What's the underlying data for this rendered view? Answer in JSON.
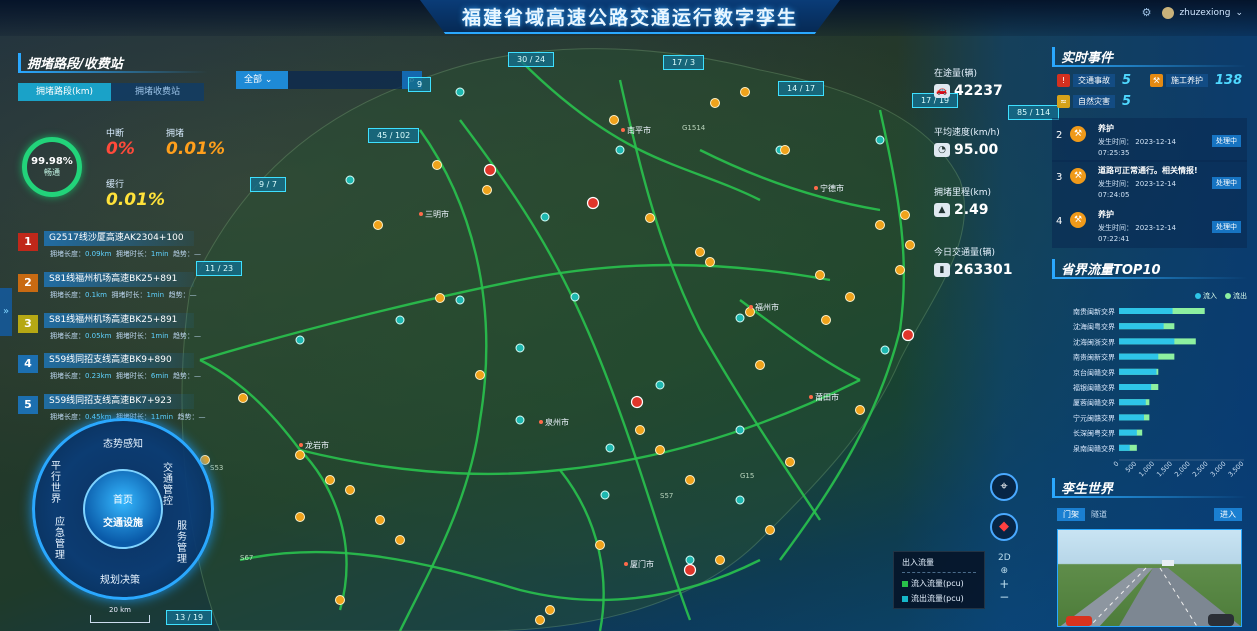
{
  "title": "福建省域高速公路交通运行数字孪生",
  "user": "zhuzexiong",
  "left": {
    "section_title": "拥堵路段/收费站",
    "tabs": [
      "拥堵路段(km)",
      "拥堵收费站"
    ],
    "ring_value": "99.98%",
    "ring_label": "畅通",
    "stats": [
      {
        "label": "中断",
        "value": "0%",
        "color": "#ff4a3a"
      },
      {
        "label": "拥堵",
        "value": "0.01%",
        "color": "#ff9f1c"
      },
      {
        "label": "缓行",
        "value": "0.01%",
        "color": "#ffe23a"
      }
    ],
    "jams": [
      {
        "rank": "1",
        "color": "#c0281a",
        "name": "G2517线沙厦高速AK2304+100",
        "len": "0.09km",
        "dur": "1min"
      },
      {
        "rank": "2",
        "color": "#c86a12",
        "name": "S81线福州机场高速BK25+891",
        "len": "0.1km",
        "dur": "1min"
      },
      {
        "rank": "3",
        "color": "#b6a814",
        "name": "S81线福州机场高速BK25+891",
        "len": "0.05km",
        "dur": "1min"
      },
      {
        "rank": "4",
        "color": "#1c6fb0",
        "name": "S59线同招支线高速BK9+890",
        "len": "0.23km",
        "dur": "6min"
      },
      {
        "rank": "5",
        "color": "#1c6fb0",
        "name": "S59线同招支线高速BK7+923",
        "len": "0.45km",
        "dur": "11min"
      }
    ],
    "jam_len_label": "拥堵长度：",
    "jam_dur_label": "拥堵时长：",
    "jam_trend_label": "趋势：",
    "jam_trend_value": "—"
  },
  "search": {
    "select": "全部"
  },
  "map": {
    "scale": "20 km",
    "seg_labels": [
      "30 / 24",
      "17 / 3",
      "14 / 17",
      "45 / 102",
      "9 / 7",
      "11 / 23",
      "85 / 114",
      "17 / 19",
      "13 / 19",
      "9"
    ],
    "cities": [
      "南平市",
      "宁德市",
      "福州市",
      "莆田市",
      "泉州市",
      "龙岩市",
      "厦门市",
      "三明市"
    ],
    "roads": [
      "G1514",
      "S57",
      "G15",
      "S67",
      "S53"
    ],
    "dial": {
      "segments": [
        "态势感知",
        "交通管控",
        "服务管理",
        "规划决策",
        "应急管理",
        "平行世界"
      ],
      "home": "首页",
      "current": "交通设施"
    },
    "controls": {
      "mode": "2D",
      "zoom_in": "+",
      "zoom_out": "−"
    }
  },
  "kpis": [
    {
      "label": "在途量(辆)",
      "value": "42237",
      "icon": "car-icon"
    },
    {
      "label": "平均速度(km/h)",
      "value": "95.00",
      "icon": "speedometer-icon"
    },
    {
      "label": "拥堵里程(km)",
      "value": "2.49",
      "icon": "road-icon"
    },
    {
      "label": "今日交通量(辆)",
      "value": "263301",
      "icon": "vehicle-icon"
    }
  ],
  "events": {
    "section_title": "实时事件",
    "chips": [
      {
        "label": "交通事故",
        "value": "5",
        "icon": "accident-icon"
      },
      {
        "label": "施工养护",
        "value": "138",
        "icon": "construction-icon"
      },
      {
        "label": "自然灾害",
        "value": "5",
        "icon": "disaster-icon"
      }
    ],
    "time_label": "发生时间：",
    "items": [
      {
        "idx": "2",
        "title": "养护",
        "date": "2023-12-14",
        "time": "07:25:35",
        "status": "处理中"
      },
      {
        "idx": "3",
        "title": "道路可正常通行。相关情报!",
        "date": "2023-12-14",
        "time": "07:24:05",
        "status": "处理中"
      },
      {
        "idx": "4",
        "title": "养护",
        "date": "2023-12-14",
        "time": "07:22:41",
        "status": "处理中"
      }
    ]
  },
  "chart_data": {
    "type": "bar",
    "title": "省界流量TOP10",
    "categories": [
      "南贵闽新交界",
      "沈海闽粤交界",
      "沈海闽浙交界",
      "南贵闽新交界",
      "京台闽赣交界",
      "福银闽赣交界",
      "厦蓉闽赣交界",
      "宁元闽赣交界",
      "长深闽粤交界",
      "泉南闽赣交界"
    ],
    "series": [
      {
        "name": "流入",
        "color": "#2ec5e8",
        "values": [
          1500,
          1250,
          1550,
          1100,
          1050,
          900,
          750,
          700,
          500,
          300
        ]
      },
      {
        "name": "流出",
        "color": "#8df0a0",
        "values": [
          2400,
          1550,
          2150,
          1550,
          1100,
          1100,
          850,
          850,
          650,
          500
        ]
      }
    ],
    "xlim": [
      0,
      3500
    ],
    "xticks": [
      "0",
      "500",
      "1,000",
      "1,500",
      "2,000",
      "2,500",
      "3,000",
      "3,500"
    ],
    "legend": "top-right"
  },
  "twin": {
    "section_title": "孪生世界",
    "tabs": [
      "门架",
      "隧道"
    ],
    "enter": "进入"
  },
  "flow_legend": {
    "title": "出入流量",
    "in": "流入流量(pcu)",
    "out": "流出流量(pcu)",
    "in_color": "#28c24a",
    "out_color": "#16b6c8"
  }
}
